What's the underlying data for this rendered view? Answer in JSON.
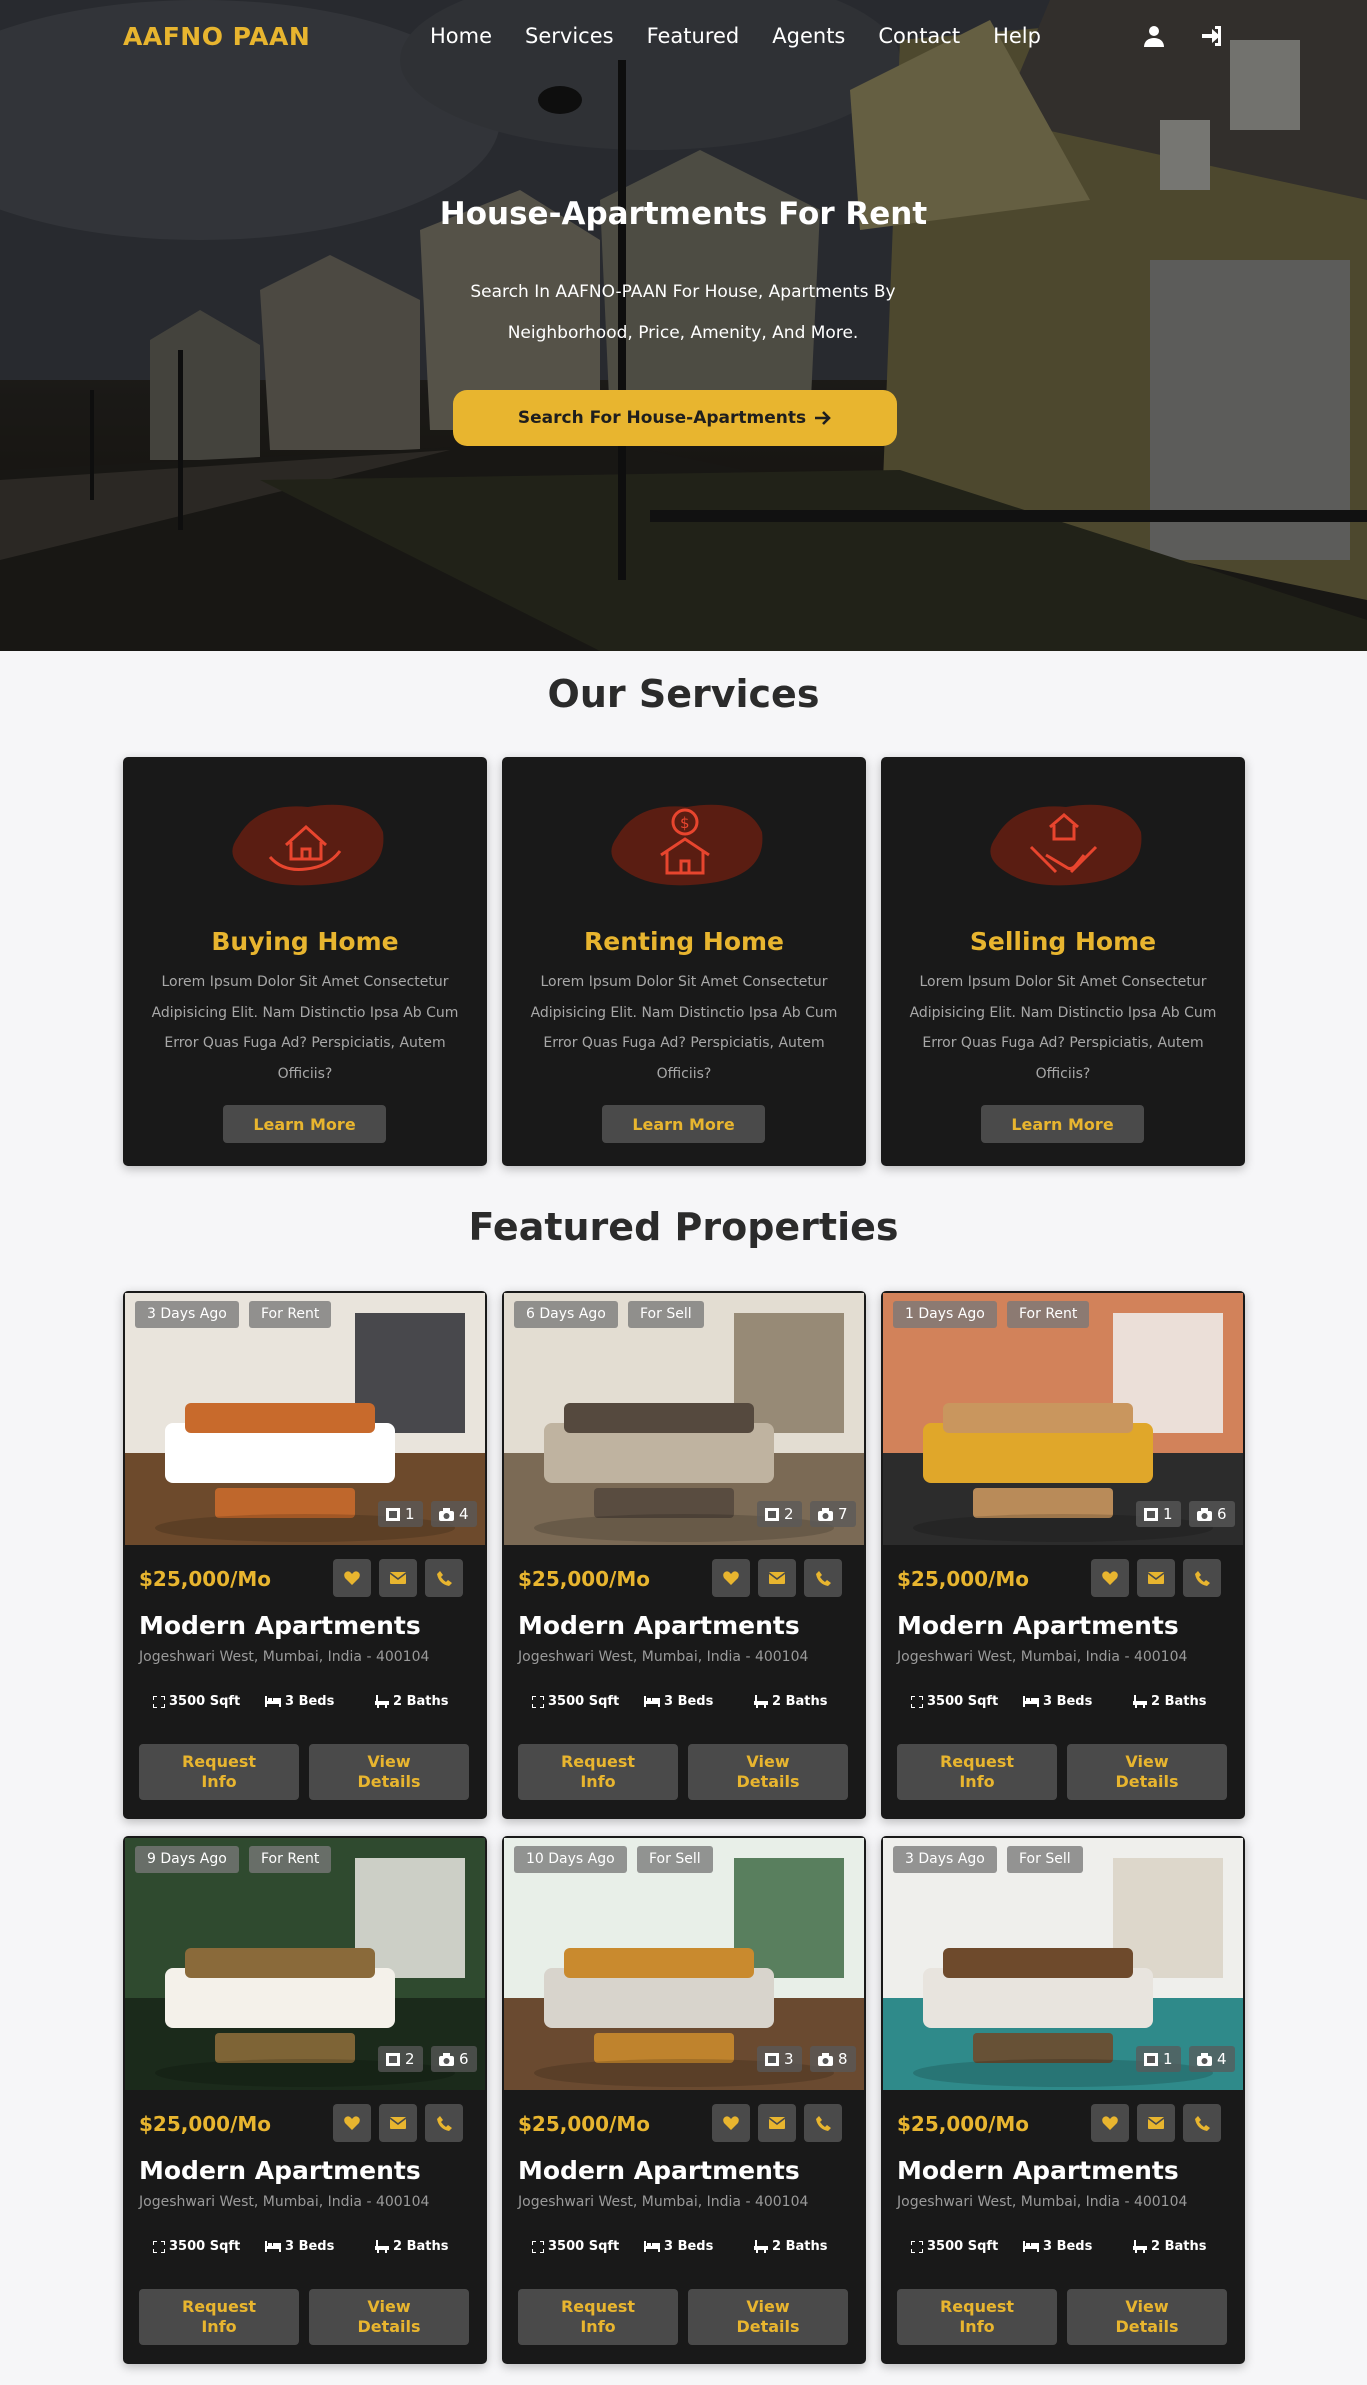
{
  "colors": {
    "accent": "#e8b52f",
    "card_bg": "#191919",
    "button_bg": "#4a4a4a",
    "page_bg": "#f6f6f8"
  },
  "nav": {
    "logo": "AAFNO PAAN",
    "links": [
      "Home",
      "Services",
      "Featured",
      "Agents",
      "Contact",
      "Help"
    ],
    "icons": [
      "user-icon",
      "sign-in-icon"
    ]
  },
  "hero": {
    "title": "House-Apartments For Rent",
    "subtitle": "Search In AAFNO-PAAN For House, Apartments By Neighborhood, Price, Amenity, And More.",
    "button_label": "Search For House-Apartments"
  },
  "services": {
    "title": "Our Services",
    "items": [
      {
        "icon": "house-in-hand-icon",
        "title": "Buying Home",
        "text": "Lorem Ipsum Dolor Sit Amet Consectetur Adipisicing Elit. Nam Distinctio Ipsa Ab Cum Error Quas Fuga Ad? Perspiciatis, Autem Officiis?",
        "button": "Learn More"
      },
      {
        "icon": "house-dollar-icon",
        "title": "Renting Home",
        "text": "Lorem Ipsum Dolor Sit Amet Consectetur Adipisicing Elit. Nam Distinctio Ipsa Ab Cum Error Quas Fuga Ad? Perspiciatis, Autem Officiis?",
        "button": "Learn More"
      },
      {
        "icon": "house-handshake-icon",
        "title": "Selling Home",
        "text": "Lorem Ipsum Dolor Sit Amet Consectetur Adipisicing Elit. Nam Distinctio Ipsa Ab Cum Error Quas Fuga Ad? Perspiciatis, Autem Officiis?",
        "button": "Learn More"
      }
    ]
  },
  "featured": {
    "title": "Featured Properties",
    "properties": [
      {
        "age": "3 Days Ago",
        "status": "For Rent",
        "videos": "1",
        "photos": "4",
        "price": "$25,000/Mo",
        "name": "Modern Apartments",
        "address": "Jogeshwari West, Mumbai, India - 400104",
        "area": "3500 Sqft",
        "beds": "3 Beds",
        "baths": "2 Baths",
        "request": "Request Info",
        "details": "View Details"
      },
      {
        "age": "6 Days Ago",
        "status": "For Sell",
        "videos": "2",
        "photos": "7",
        "price": "$25,000/Mo",
        "name": "Modern Apartments",
        "address": "Jogeshwari West, Mumbai, India - 400104",
        "area": "3500 Sqft",
        "beds": "3 Beds",
        "baths": "2 Baths",
        "request": "Request Info",
        "details": "View Details"
      },
      {
        "age": "1 Days Ago",
        "status": "For Rent",
        "videos": "1",
        "photos": "6",
        "price": "$25,000/Mo",
        "name": "Modern Apartments",
        "address": "Jogeshwari West, Mumbai, India - 400104",
        "area": "3500 Sqft",
        "beds": "3 Beds",
        "baths": "2 Baths",
        "request": "Request Info",
        "details": "View Details"
      },
      {
        "age": "9 Days Ago",
        "status": "For Rent",
        "videos": "2",
        "photos": "6",
        "price": "$25,000/Mo",
        "name": "Modern Apartments",
        "address": "Jogeshwari West, Mumbai, India - 400104",
        "area": "3500 Sqft",
        "beds": "3 Beds",
        "baths": "2 Baths",
        "request": "Request Info",
        "details": "View Details"
      },
      {
        "age": "10 Days Ago",
        "status": "For Sell",
        "videos": "3",
        "photos": "8",
        "price": "$25,000/Mo",
        "name": "Modern Apartments",
        "address": "Jogeshwari West, Mumbai, India - 400104",
        "area": "3500 Sqft",
        "beds": "3 Beds",
        "baths": "2 Baths",
        "request": "Request Info",
        "details": "View Details"
      },
      {
        "age": "3 Days Ago",
        "status": "For Sell",
        "videos": "1",
        "photos": "4",
        "price": "$25,000/Mo",
        "name": "Modern Apartments",
        "address": "Jogeshwari West, Mumbai, India - 400104",
        "area": "3500 Sqft",
        "beds": "3 Beds",
        "baths": "2 Baths",
        "request": "Request Info",
        "details": "View Details"
      }
    ]
  }
}
